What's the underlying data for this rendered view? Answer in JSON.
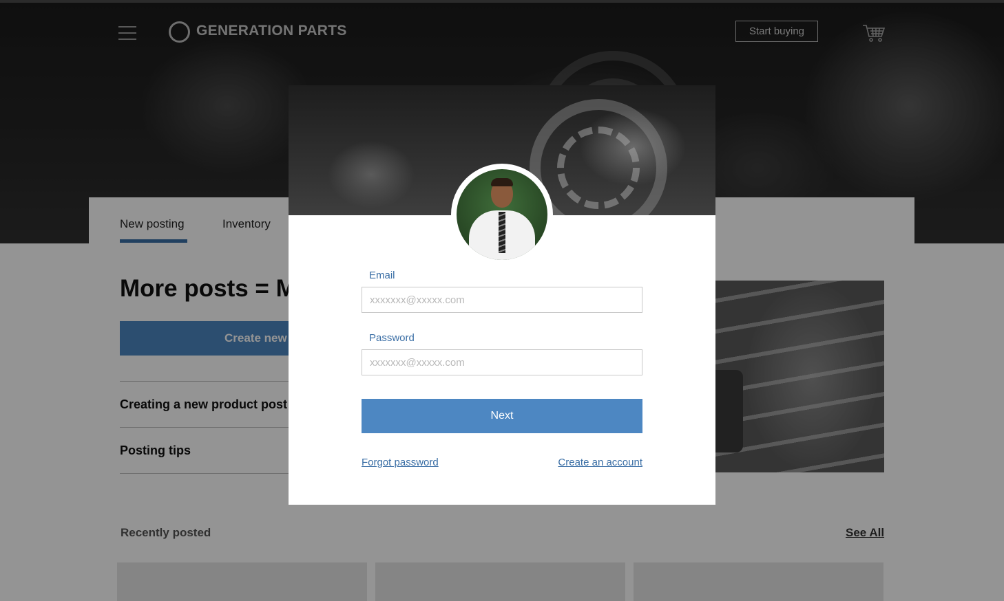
{
  "header": {
    "brand": "GENERATION PARTS",
    "start_buying_label": "Start buying"
  },
  "tabs": [
    {
      "label": "New posting",
      "active": true
    },
    {
      "label": "Inventory",
      "active": false
    }
  ],
  "main": {
    "promo_title": "More posts = M",
    "create_button_label": "Create new",
    "list_items": [
      {
        "label": "Creating a new product post"
      },
      {
        "label": "Posting tips"
      }
    ],
    "recent_title": "Recently posted",
    "see_all_label": "See All"
  },
  "modal": {
    "email_label": "Email",
    "email_placeholder": "xxxxxxx@xxxxx.com",
    "password_label": "Password",
    "password_placeholder": "xxxxxxx@xxxxx.com",
    "next_label": "Next",
    "forgot_password_label": "Forgot password",
    "create_account_label": "Create an account"
  },
  "colors": {
    "accent": "#4d87c2",
    "link": "#3a6ea5",
    "tab_underline": "#3a6ea5"
  },
  "icons": [
    "hamburger-icon",
    "logo-circle-icon",
    "cart-icon"
  ]
}
